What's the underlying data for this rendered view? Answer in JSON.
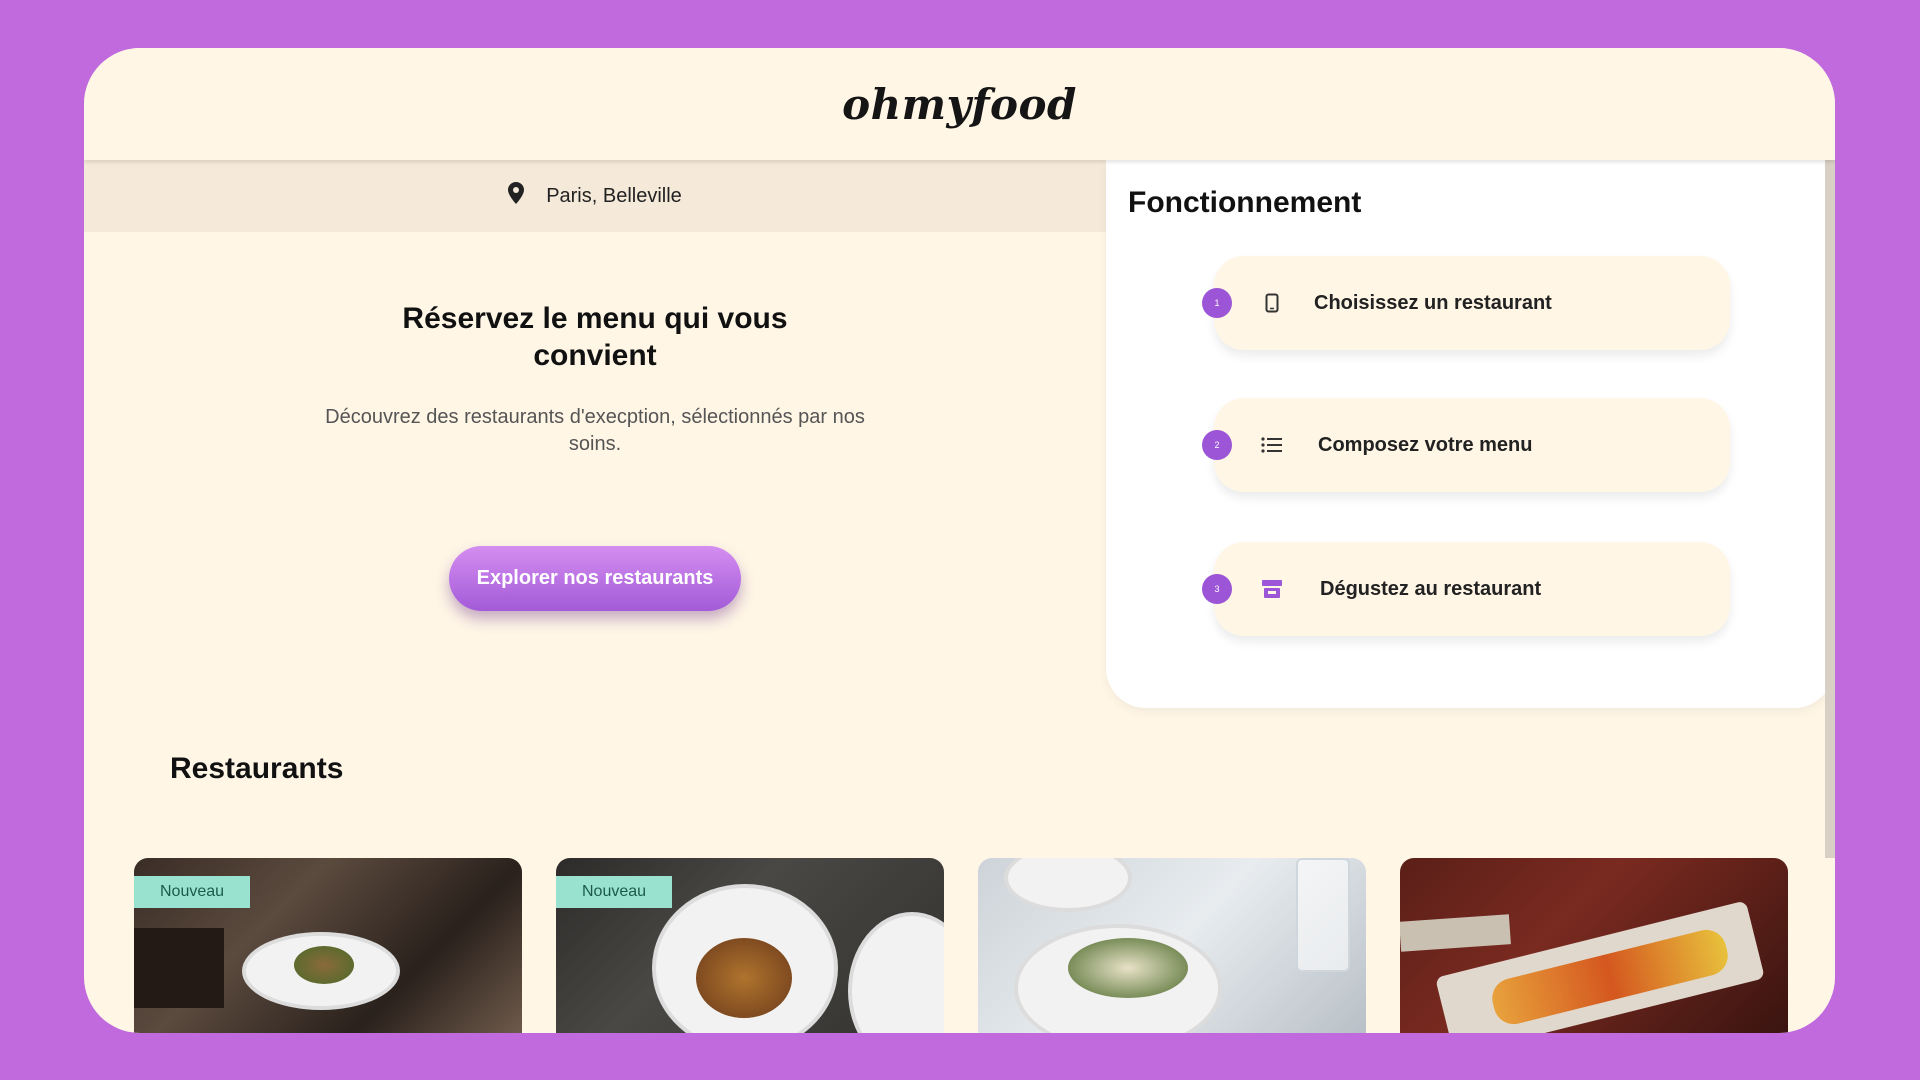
{
  "header": {
    "logo": "ohmyfood"
  },
  "location": {
    "icon": "location-pin-icon",
    "text": "Paris, Belleville"
  },
  "hero": {
    "title": "Réservez le menu qui vous convient",
    "subtitle": "Découvrez des restaurants d'execption, sélectionnés par nos soins.",
    "cta_label": "Explorer nos restaurants"
  },
  "how_it_works": {
    "title": "Fonctionnement",
    "steps": [
      {
        "number": "1",
        "icon": "phone-icon",
        "label": "Choisissez un restaurant"
      },
      {
        "number": "2",
        "icon": "list-icon",
        "label": "Composez votre menu"
      },
      {
        "number": "3",
        "icon": "store-icon",
        "label": "Dégustez au restaurant"
      }
    ]
  },
  "restaurants": {
    "title": "Restaurants",
    "cards": [
      {
        "badge": "Nouveau"
      },
      {
        "badge": "Nouveau"
      },
      {
        "badge": ""
      },
      {
        "badge": ""
      }
    ]
  },
  "colors": {
    "background": "#c06ade",
    "page": "#fff6e6",
    "accent": "#9b55d6",
    "badge": "#99e2d0"
  }
}
